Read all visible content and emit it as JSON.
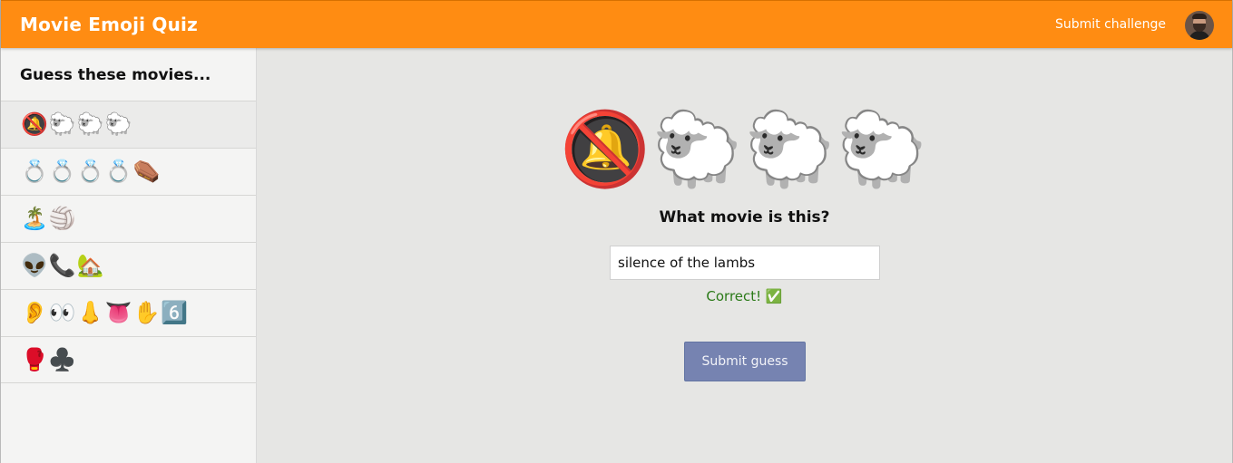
{
  "header": {
    "title": "Movie Emoji Quiz",
    "submit_challenge_label": "Submit challenge",
    "brand_color": "#ff8c12"
  },
  "sidebar": {
    "heading": "Guess these movies...",
    "items": [
      {
        "emoji": "🔕🐑🐑🐑",
        "active": true
      },
      {
        "emoji": "💍💍💍💍⚰️"
      },
      {
        "emoji": "🏝️🏐"
      },
      {
        "emoji": "👽📞🏡"
      },
      {
        "emoji": "👂👀👃👅✋6️⃣"
      },
      {
        "emoji": "🥊♣️"
      }
    ]
  },
  "quiz": {
    "emoji": "🔕🐑🐑🐑",
    "question": "What movie is this?",
    "answer_value": "silence of the lambs",
    "result_text": "Correct! ✅",
    "submit_label": "Submit guess",
    "result_color": "#2b7a18"
  }
}
